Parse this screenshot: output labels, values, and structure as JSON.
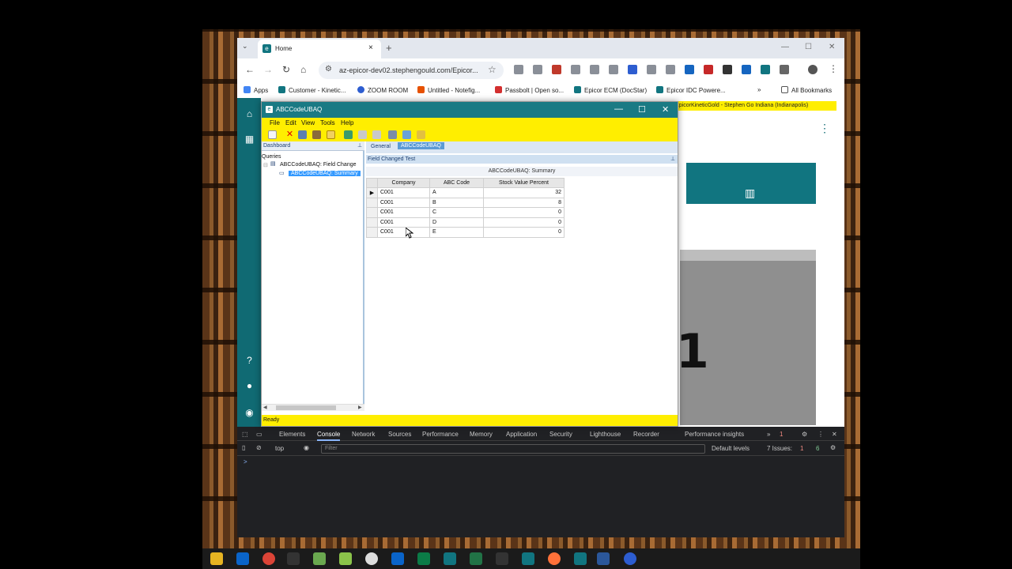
{
  "browser": {
    "tab_title": "Home",
    "url": "az-epicor-dev02.stephengould.com/Epicor...",
    "bookmarks": [
      "Apps",
      "Customer - Kinetic...",
      "ZOOM ROOM",
      "Untitled - Notefig...",
      "Passbolt | Open so...",
      "Epicor ECM (DocStar)",
      "Epicor IDC Powere...",
      "All Bookmarks"
    ]
  },
  "page": {
    "yellow_banner": "d - EpicorKineticGold - Stephen Go   Indiana (Indianapolis)",
    "big_char": "1"
  },
  "dialog": {
    "title": "ABCCodeUBAQ",
    "menu": [
      "File",
      "Edit",
      "View",
      "Tools",
      "Help"
    ],
    "dashboard_label": "Dashboard",
    "tree_queries": "Queries",
    "tree_node1": "ABCCodeUBAQ: Field Change",
    "tree_node2": "ABCCodeUBAQ: Summary",
    "tabs": [
      "General",
      "ABCCodeUBAQ"
    ],
    "panel_title": "Field Changed Test",
    "grid_title": "ABCCodeUBAQ: Summary",
    "columns": [
      "Company",
      "ABC Code",
      "Stock Value Percent"
    ],
    "rows": [
      {
        "company": "C001",
        "code": "A",
        "pct": "32"
      },
      {
        "company": "C001",
        "code": "B",
        "pct": "8"
      },
      {
        "company": "C001",
        "code": "C",
        "pct": "0"
      },
      {
        "company": "C001",
        "code": "D",
        "pct": "0"
      },
      {
        "company": "C001",
        "code": "E",
        "pct": "0"
      }
    ],
    "status": "Ready"
  },
  "devtools": {
    "tabs": [
      "Elements",
      "Console",
      "Network",
      "Sources",
      "Performance",
      "Memory",
      "Application",
      "Security",
      "Lighthouse",
      "Recorder",
      "Performance insights"
    ],
    "context": "top",
    "filter_placeholder": "Filter",
    "levels": "Default levels",
    "issues": "7 Issues:",
    "issues_red": "1",
    "issues_green": "6",
    "badge_count": "1",
    "prompt": ">"
  }
}
